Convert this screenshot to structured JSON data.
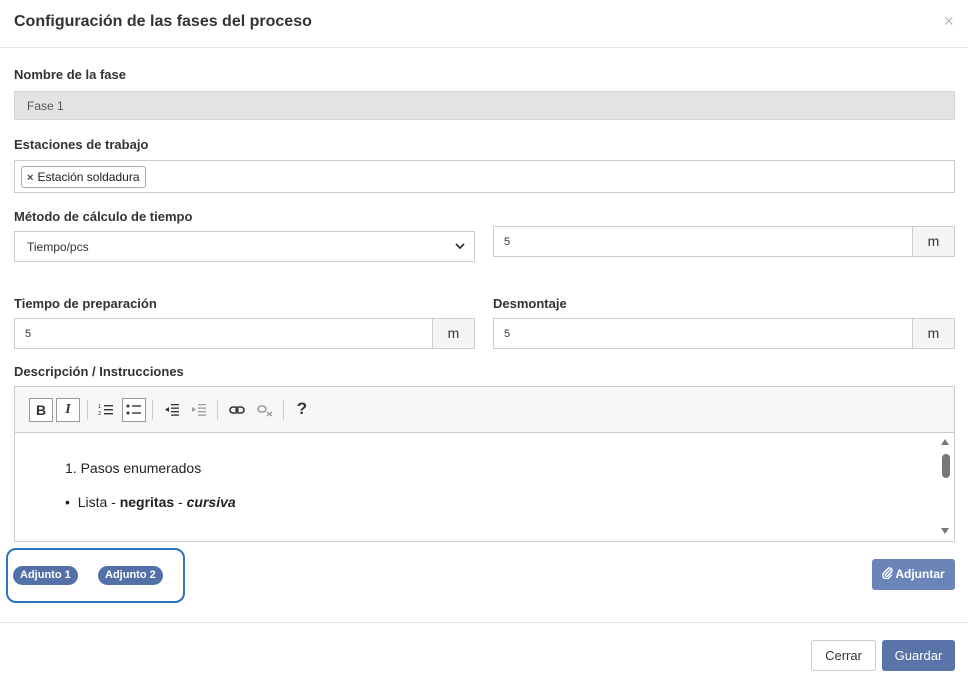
{
  "modal": {
    "title": "Configuración de las fases del proceso",
    "close_label": "×"
  },
  "phase_name": {
    "label": "Nombre de la fase",
    "value": "Fase 1"
  },
  "workstations": {
    "label": "Estaciones de trabajo",
    "tags": [
      {
        "remove": "×",
        "label": "Estación soldadura"
      }
    ]
  },
  "time_method": {
    "label": "Método de cálculo de tiempo",
    "selected": "Tiempo/pcs",
    "value": "5",
    "unit": "m"
  },
  "setup_time": {
    "label": "Tiempo de preparación",
    "value": "5",
    "unit": "m"
  },
  "teardown": {
    "label": "Desmontaje",
    "value": "5",
    "unit": "m"
  },
  "description": {
    "label": "Descripción / Instrucciones",
    "toolbar": {
      "bold": "B",
      "italic": "I",
      "help": "?"
    },
    "content": {
      "numbered_item": "1. Pasos enumerados",
      "bullet": "•",
      "bullet_text_1": "Lista - ",
      "bullet_bold": "negritas",
      "bullet_text_2": " - ",
      "bullet_italic": "cursiva"
    }
  },
  "attachments": [
    {
      "label": "Adjunto 1"
    },
    {
      "label": "Adjunto 2"
    }
  ],
  "buttons": {
    "attach": "Adjuntar",
    "close": "Cerrar",
    "save": "Guardar"
  },
  "colors": {
    "primary": "#5a74aa",
    "chip": "#5470a8",
    "highlight": "#2b74c2"
  }
}
